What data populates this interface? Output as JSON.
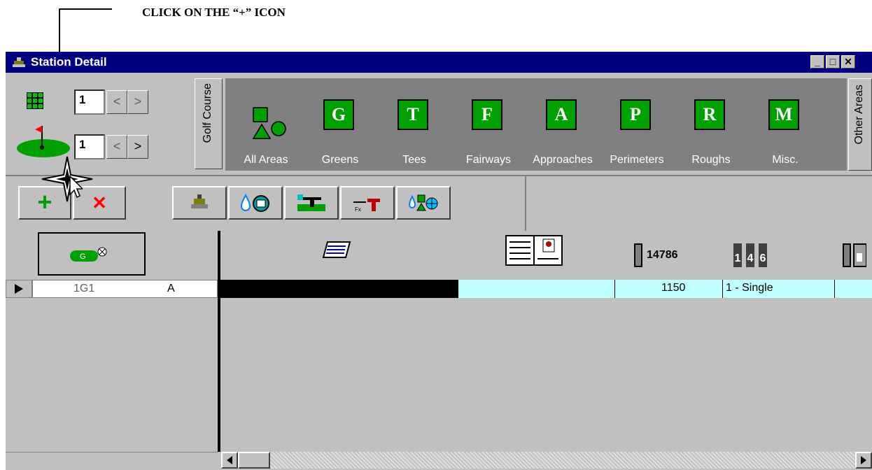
{
  "callout": {
    "text": "CLICK ON THE “+” ICON"
  },
  "window": {
    "title": "Station Detail",
    "buttons": [
      "_",
      "□",
      "✕"
    ]
  },
  "selectors": {
    "course_value": "1",
    "hole_value": "1",
    "prev_label": "<",
    "next_label": ">"
  },
  "golf_course_tab": "Golf Course",
  "other_areas_tab": "Other Areas",
  "areas": [
    {
      "label": "All Areas",
      "letter": ""
    },
    {
      "label": "Greens",
      "letter": "G"
    },
    {
      "label": "Tees",
      "letter": "T"
    },
    {
      "label": "Fairways",
      "letter": "F"
    },
    {
      "label": "Approaches",
      "letter": "A"
    },
    {
      "label": "Perimeters",
      "letter": "P"
    },
    {
      "label": "Roughs",
      "letter": "R"
    },
    {
      "label": "Misc.",
      "letter": "M"
    }
  ],
  "toolbar": {
    "add_label": "+",
    "delete_label": "✕"
  },
  "grid": {
    "header_icon_label": "G",
    "count_value": "14786",
    "digits": [
      "1",
      "4",
      "6"
    ],
    "rows": [
      {
        "station": "1G1",
        "area": "A",
        "number": "1150",
        "type": "1 - Single"
      }
    ]
  },
  "colors": {
    "titlebar": "#000080",
    "area_green": "#00a000",
    "row_cyan": "#c0ffff"
  }
}
